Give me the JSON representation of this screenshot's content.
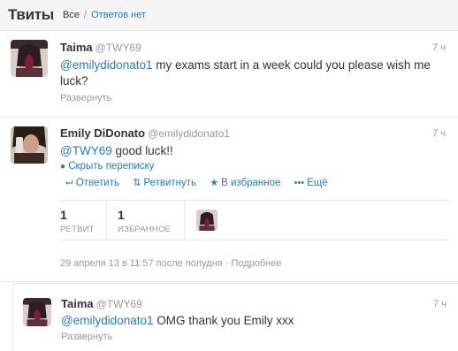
{
  "header": {
    "title": "Твиты",
    "filter_all": "Все",
    "filter_sep": "/",
    "filter_noreplies": "Ответов нет"
  },
  "tweets": [
    {
      "name": "Taima",
      "handle": "@TWY69",
      "time": "7 ч",
      "mention": "@emilydidonato1",
      "text": " my exams start in a week could you please wish me luck?",
      "expand": "Развернуть"
    },
    {
      "name": "Emily DiDonato",
      "handle": "@emilydidonato1",
      "time": "7 ч",
      "mention": "@TWY69",
      "text": " good luck!!",
      "hide_convo": "Скрыть переписку",
      "actions": {
        "reply": "Ответить",
        "retweet": "Ретвитнуть",
        "favorite": "В избранное",
        "more": "Ещё"
      },
      "stats": {
        "retweets_count": "1",
        "retweets_label": "РЕТВИТ",
        "favorites_count": "1",
        "favorites_label": "ИЗБРАННОЕ"
      },
      "timestamp": "29 апреля 13 в 11:57 после полудня",
      "details_sep": "·",
      "details": "Подробнее"
    },
    {
      "name": "Taima",
      "handle": "@TWY69",
      "time": "7 ч",
      "mention": "@emilydidonato1",
      "text": " OMG thank you Emily xxx",
      "expand": "Развернуть"
    }
  ],
  "icons": {
    "reply": "reply-arrow-icon",
    "retweet": "retweet-icon",
    "favorite": "star-icon",
    "more": "ellipsis-icon",
    "conversation": "speech-bubble-icon"
  },
  "colors": {
    "link": "#2a7ab4",
    "muted": "#999999",
    "header_bg": "#f5f5f5"
  }
}
